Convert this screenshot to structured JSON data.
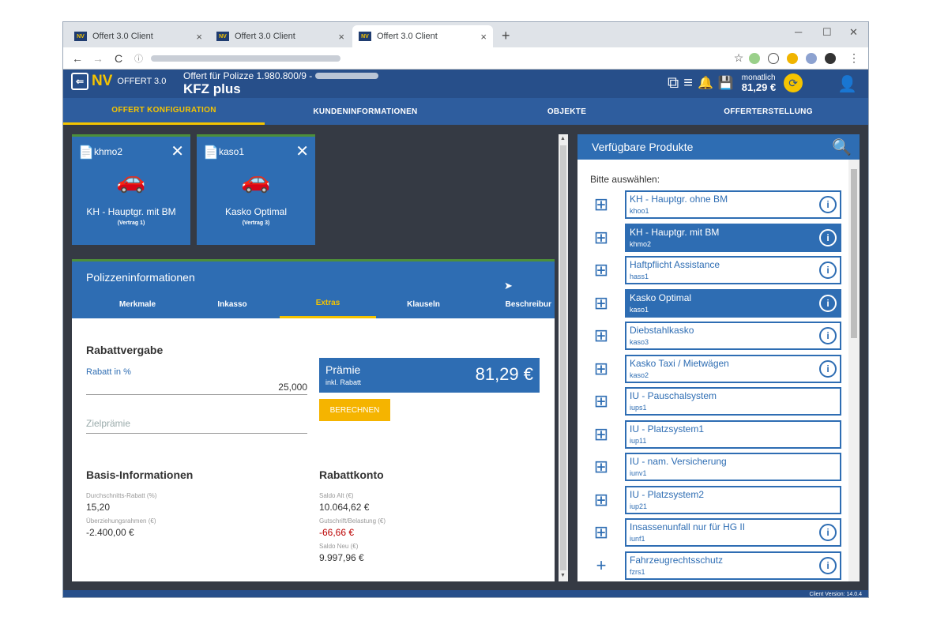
{
  "browser": {
    "tabs": [
      {
        "label": "Offert 3.0 Client",
        "favicon": "NV"
      },
      {
        "label": "Offert 3.0 Client",
        "favicon": "NV"
      },
      {
        "label": "Offert 3.0 Client",
        "favicon": "NV"
      }
    ],
    "close_glyph": "×",
    "newtab_glyph": "+",
    "minimize_glyph": "─",
    "maximize_glyph": "☐",
    "winclose_glyph": "✕",
    "back_glyph": "←",
    "forward_glyph": "→",
    "reload_glyph": "C",
    "info_glyph": "ⓘ",
    "star_glyph": "☆",
    "menu_glyph": "⋮"
  },
  "app": {
    "logo_nv": "NV",
    "logo_text": "OFFERT 3.0",
    "logo_icon_glyph": "⇐",
    "title_line1": "Offert für Polizze 1.980.800/9 -",
    "title_line2": "KFZ plus",
    "price_label": "monatlich",
    "price_value": "81,29 €",
    "icons": {
      "copy": "⧉",
      "list": "≡",
      "bell": "🔔",
      "save": "💾",
      "sync": "⟳",
      "user": "👤"
    },
    "main_tabs": [
      {
        "label": "OFFERT KONFIGURATION"
      },
      {
        "label": "KUNDENINFORMATIONEN"
      },
      {
        "label": "OBJEKTE"
      },
      {
        "label": "OFFERTERSTELLUNG"
      }
    ]
  },
  "cards": [
    {
      "id": "khmo2",
      "name": "KH - Hauptgr. mit BM",
      "contract": "(Vertrag 1)"
    },
    {
      "id": "kaso1",
      "name": "Kasko Optimal",
      "contract": "(Vertrag 3)"
    }
  ],
  "card_glyphs": {
    "doc": "📄",
    "close": "✕",
    "car": "🚗"
  },
  "policy": {
    "title": "Polizzeninformationen",
    "tabs": [
      {
        "label": "Merkmale"
      },
      {
        "label": "Inkasso"
      },
      {
        "label": "Extras"
      },
      {
        "label": "Klauseln"
      },
      {
        "label": "Beschreibur"
      }
    ],
    "rabatt_title": "Rabattvergabe",
    "rabatt_label": "Rabatt in %",
    "rabatt_value": "25,000",
    "ziel_placeholder": "Zielprämie",
    "praemie_title": "Prämie",
    "praemie_sub": "inkl. Rabatt",
    "praemie_value": "81,29 €",
    "button": "BERECHNEN",
    "basis_title": "Basis-Informationen",
    "basis": [
      {
        "label": "Durchschnitts-Rabatt (%)",
        "value": "15,20"
      },
      {
        "label": "Überziehungsrahmen (€)",
        "value": "-2.400,00 €"
      }
    ],
    "konto_title": "Rabattkonto",
    "konto": [
      {
        "label": "Saldo Alt (€)",
        "value": "10.064,62 €"
      },
      {
        "label": "Gutschrift/Belastung (€)",
        "value": "-66,66 €"
      },
      {
        "label": "Saldo Neu (€)",
        "value": "9.997,96 €"
      }
    ]
  },
  "products": {
    "title": "Verfügbare Produkte",
    "search_glyph": "🔍",
    "prompt": "Bitte auswählen:",
    "add_glyph": "⊞",
    "plus_glyph": "+",
    "info_glyph": "i",
    "items": [
      {
        "name": "KH - Hauptgr. ohne BM",
        "code": "khoo1"
      },
      {
        "name": "KH - Hauptgr. mit BM",
        "code": "khmo2"
      },
      {
        "name": "Haftpflicht Assistance",
        "code": "hass1"
      },
      {
        "name": "Kasko Optimal",
        "code": "kaso1"
      },
      {
        "name": "Diebstahlkasko",
        "code": "kaso3"
      },
      {
        "name": "Kasko Taxi / Mietwägen",
        "code": "kaso2"
      },
      {
        "name": "IU - Pauschalsystem",
        "code": "iups1"
      },
      {
        "name": "IU - Platzsystem1",
        "code": "iup11"
      },
      {
        "name": "IU - nam. Versicherung",
        "code": "iunv1"
      },
      {
        "name": "IU - Platzsystem2",
        "code": "iup21"
      },
      {
        "name": "Insassenunfall nur für HG II",
        "code": "iunf1"
      },
      {
        "name": "Fahrzeugrechtsschutz",
        "code": "fzrs1"
      }
    ]
  },
  "status": {
    "version": "Client Version: 14.0.4"
  },
  "colors": {
    "primary": "#2e6db3",
    "accent": "#f5c400",
    "green": "#4d8f3a"
  }
}
